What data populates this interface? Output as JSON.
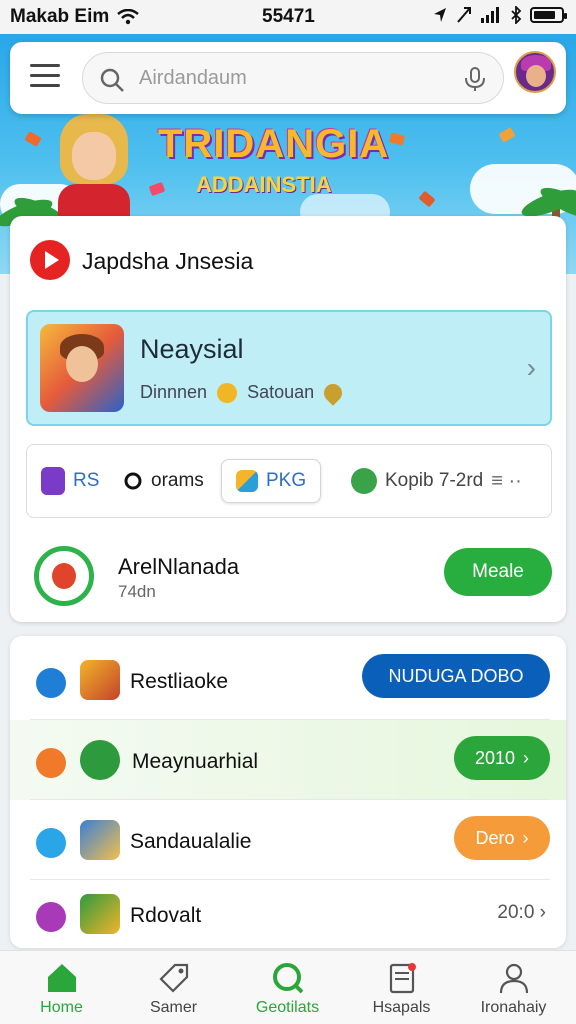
{
  "status": {
    "carrier": "Makab Eim",
    "time": "55471",
    "battery_level": 0.8
  },
  "search": {
    "placeholder": "Airdandaum"
  },
  "banner": {
    "title": "TRIDANGIA",
    "subtitle": "ADDAINSTIA"
  },
  "main_card": {
    "title": "Japdsha Jnsesia",
    "featured": {
      "name": "Neaysial",
      "meta_left": "Dinnnen",
      "meta_right": "Satouan"
    },
    "chips": [
      {
        "icon": "rs-icon",
        "label": "RS"
      },
      {
        "icon": "programs-icon",
        "label": "orams"
      },
      {
        "icon": "pkg-icon",
        "label": "PKG"
      },
      {
        "icon": "kopi-icon",
        "label": "Kopib 7-2rd"
      }
    ],
    "app": {
      "name": "ArelNlanada",
      "sub": "74dn",
      "button": "Meale"
    }
  },
  "list": [
    {
      "label": "Restliaoke",
      "action": "NUDUGA DOBO",
      "action_color": "#0a5fb8"
    },
    {
      "label": "Meaynuarhial",
      "action": "2010",
      "action_color": "#2aa63a"
    },
    {
      "label": "Sandaualalie",
      "action": "Dero",
      "action_color": "#f69b3a"
    },
    {
      "label": "Rdovalt",
      "value": "20:0"
    }
  ],
  "nav": [
    {
      "label": "Home",
      "icon": "home-icon",
      "active": true
    },
    {
      "label": "Samer",
      "icon": "tag-icon"
    },
    {
      "label": "Geotilats",
      "icon": "search-circle-icon"
    },
    {
      "label": "Hsapals",
      "icon": "document-icon"
    },
    {
      "label": "Ironahaiy",
      "icon": "profile-icon"
    }
  ],
  "colors": {
    "accent_green": "#27ae3e",
    "featured_bg": "#bfeef6",
    "youtube_red": "#e62323"
  }
}
